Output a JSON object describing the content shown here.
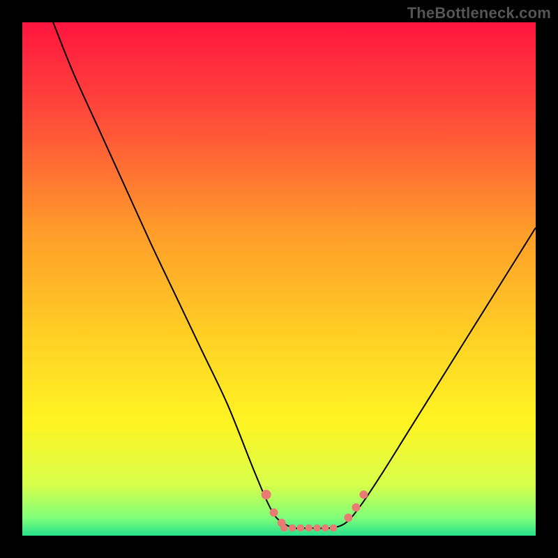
{
  "watermark": "TheBottleneck.com",
  "gradient": {
    "stops": [
      {
        "pct": 0,
        "color": "#ff153f"
      },
      {
        "pct": 18,
        "color": "#ff4a3a"
      },
      {
        "pct": 40,
        "color": "#ff9a2a"
      },
      {
        "pct": 62,
        "color": "#ffd224"
      },
      {
        "pct": 78,
        "color": "#fff423"
      },
      {
        "pct": 90,
        "color": "#d8ff4a"
      },
      {
        "pct": 96.5,
        "color": "#7fff7a"
      },
      {
        "pct": 100,
        "color": "#28e18c"
      }
    ]
  },
  "chart_data": {
    "type": "line",
    "title": "",
    "xlabel": "",
    "ylabel": "",
    "xlim": [
      0,
      100
    ],
    "ylim": [
      0,
      100
    ],
    "series": [
      {
        "name": "bottleneck-curve",
        "x": [
          6,
          10,
          15,
          20,
          25,
          30,
          35,
          40,
          45,
          48,
          50,
          53,
          56,
          60,
          63,
          66,
          70,
          75,
          80,
          85,
          90,
          95,
          100
        ],
        "y": [
          100,
          90,
          79,
          68,
          57,
          46.5,
          36,
          25.5,
          13,
          6,
          3,
          1.5,
          1.5,
          1.5,
          2.5,
          6,
          12,
          20,
          28,
          36,
          44,
          52,
          60
        ]
      }
    ],
    "markers": {
      "name": "highlight-dots",
      "color": "#e97b74",
      "points": [
        {
          "x": 47.5,
          "y": 8,
          "r": 7
        },
        {
          "x": 49,
          "y": 4.5,
          "r": 6
        },
        {
          "x": 50.5,
          "y": 2.5,
          "r": 6
        },
        {
          "x": 63.5,
          "y": 3.5,
          "r": 6
        },
        {
          "x": 65,
          "y": 5.5,
          "r": 6
        },
        {
          "x": 66.5,
          "y": 8,
          "r": 6
        }
      ],
      "bottom_band": {
        "x0": 51,
        "x1": 62,
        "y": 1.5,
        "r": 5.2,
        "step": 1.6
      }
    }
  }
}
